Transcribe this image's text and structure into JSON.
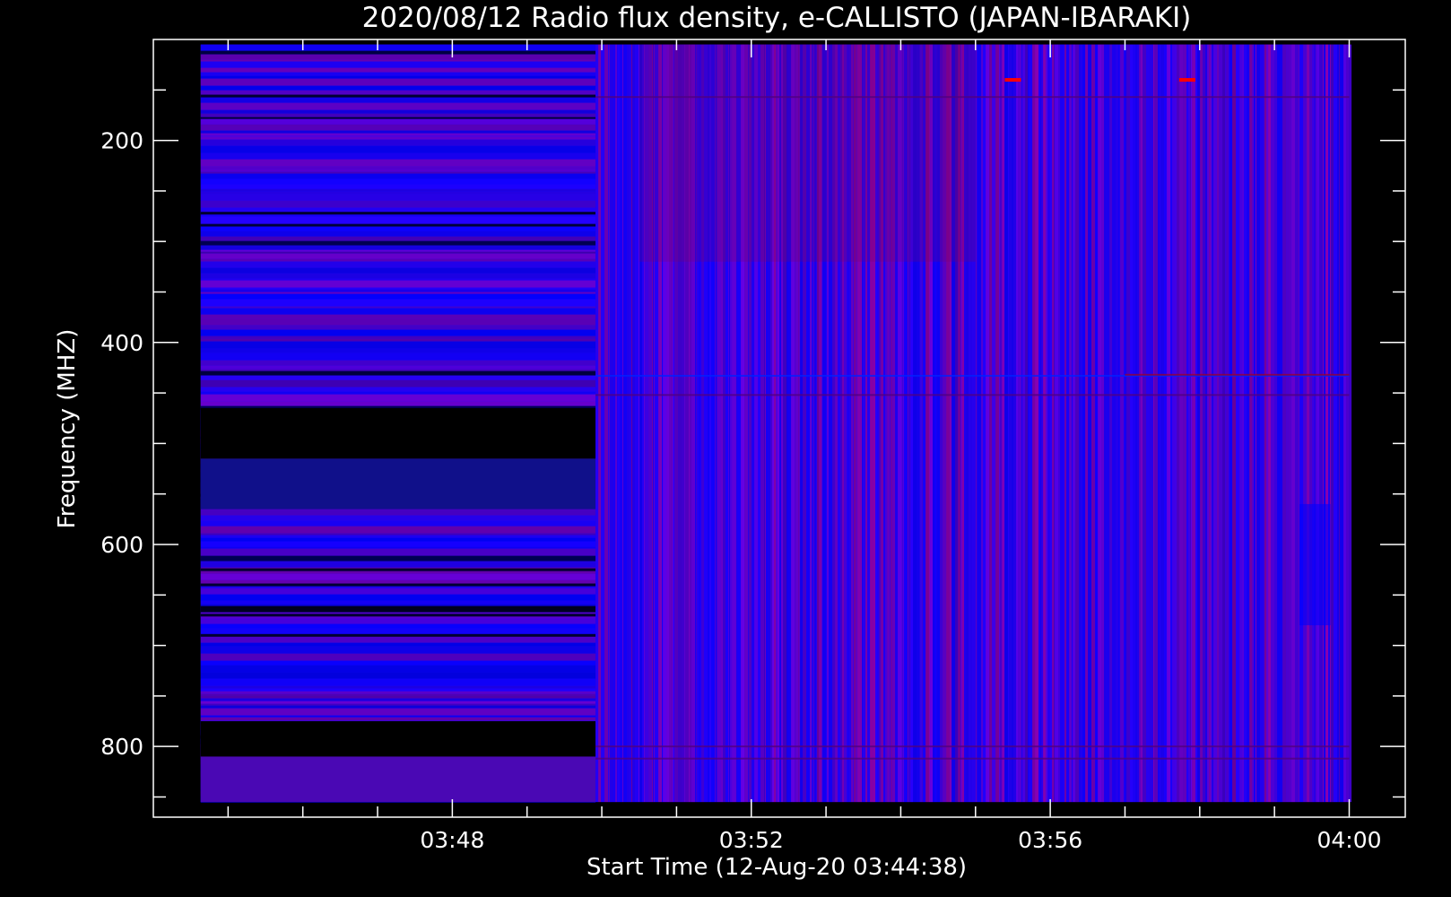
{
  "chart_data": {
    "type": "heatmap",
    "title": "2020/08/12  Radio flux density, e-CALLISTO (JAPAN-IBARAKI)",
    "xlabel": "Start Time (12-Aug-20 03:44:38)",
    "ylabel": "Frequency (MHZ)",
    "x_ticks": [
      "03:48",
      "03:52",
      "03:56",
      "04:00"
    ],
    "y_ticks": [
      200,
      400,
      600,
      800
    ],
    "xlim": [
      "03:44:00",
      "04:00:45"
    ],
    "ylim": [
      870,
      100
    ],
    "data_time_range": [
      "03:44:38",
      "04:00:00"
    ],
    "data_freq_range": [
      105,
      855
    ],
    "left_segment_end_time": "03:49:55",
    "no_data_bands_mhz": [
      [
        465,
        515
      ],
      [
        775,
        810
      ]
    ],
    "emission_spots": [
      {
        "time": "03:55:30",
        "freq": 140
      },
      {
        "time": "03:57:50",
        "freq": 140
      }
    ],
    "colors": {
      "background": "#000000",
      "axis": "#ffffff",
      "low": "#0000ff",
      "mid": "#4000c8",
      "high": "#ff0000"
    }
  }
}
